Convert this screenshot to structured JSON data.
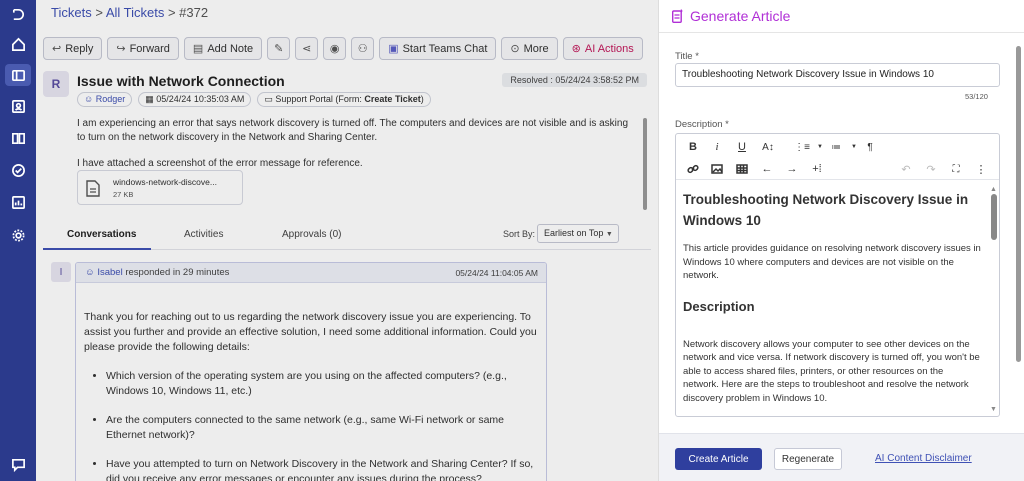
{
  "nav": {
    "items": [
      {
        "name": "logo",
        "icon": "logo-icon"
      },
      {
        "name": "home",
        "icon": "home-icon"
      },
      {
        "name": "tickets",
        "icon": "ticket-icon",
        "active": true
      },
      {
        "name": "contacts",
        "icon": "contact-card-icon"
      },
      {
        "name": "knowledge-base",
        "icon": "book-icon"
      },
      {
        "name": "tasks",
        "icon": "check-circle-icon"
      },
      {
        "name": "reports",
        "icon": "chart-icon"
      },
      {
        "name": "settings",
        "icon": "gear-icon"
      },
      {
        "name": "chat",
        "icon": "chat-icon"
      }
    ]
  },
  "breadcrumb": {
    "tickets": "Tickets",
    "sep1": " > ",
    "all": "All Tickets",
    "sep2": " > ",
    "current": "#372"
  },
  "toolbar": {
    "reply": "Reply",
    "forward": "Forward",
    "add_note": "Add Note",
    "teams": "Start Teams Chat",
    "more": "More",
    "ai": "AI Actions"
  },
  "ticket": {
    "avatar": "R",
    "title": "Issue with Network Connection",
    "status": "Resolved : 05/24/24 3:58:52 PM",
    "requester": "Rodger",
    "created": "05/24/24 10:35:03 AM",
    "source_prefix": "Support Portal (Form: ",
    "source_form": "Create Ticket",
    "source_suffix": ")",
    "body_p1": "I am experiencing an error that says network discovery is turned off. The computers and devices are not visible and is asking to turn on the network discovery in the Network and Sharing Center.",
    "body_p2": "I have attached a screenshot of the error message for reference.",
    "attachment": {
      "name": "windows-network-discove...",
      "size": "27 KB"
    }
  },
  "tabs": {
    "conversations": "Conversations",
    "activities": "Activities",
    "approvals": "Approvals (0)"
  },
  "sort": {
    "label": "Sort By:",
    "value": "Earliest on Top"
  },
  "conversation": {
    "avatar": "I",
    "author": "Isabel",
    "responded": " responded in 29 minutes",
    "timestamp": "05/24/24 11:04:05 AM",
    "intro": "Thank you for reaching out to us regarding the network discovery issue you are experiencing. To assist you further and provide an effective solution, I need some additional information. Could you please provide the following details:",
    "bullets": [
      "Which version of the operating system are you using on the affected computers? (e.g., Windows 10, Windows 11, etc.)",
      "Are the computers connected to the same network (e.g., same Wi-Fi network or same Ethernet network)?",
      "Have you attempted to turn on Network Discovery in the Network and Sharing Center? If so, did you receive any error messages or encounter any issues during the process?"
    ]
  },
  "panel": {
    "title": "Generate Article",
    "title_label": "Title *",
    "title_value": "Troubleshooting Network Discovery Issue in Windows 10",
    "char_count": "53/120",
    "desc_label": "Description *",
    "editor": {
      "heading": "Troubleshooting Network Discovery Issue in Windows 10",
      "intro": "This article provides guidance on resolving network discovery issues in Windows 10 where computers and devices are not visible on the network.",
      "subheading": "Description",
      "para": "Network discovery allows your computer to see other devices on the network and vice versa. If network discovery is turned off, you won't be able to access shared files, printers, or other resources on the network. Here are the steps to troubleshoot and resolve the network discovery problem in Windows 10."
    },
    "create_button": "Create Article",
    "regenerate_button": "Regenerate",
    "disclaimer_link": "AI Content Disclaimer"
  },
  "colors": {
    "rail": "#2b3a8c",
    "primary": "#2f3f9e",
    "accent_ai": "#b02fd6",
    "link": "#3f51b5"
  }
}
